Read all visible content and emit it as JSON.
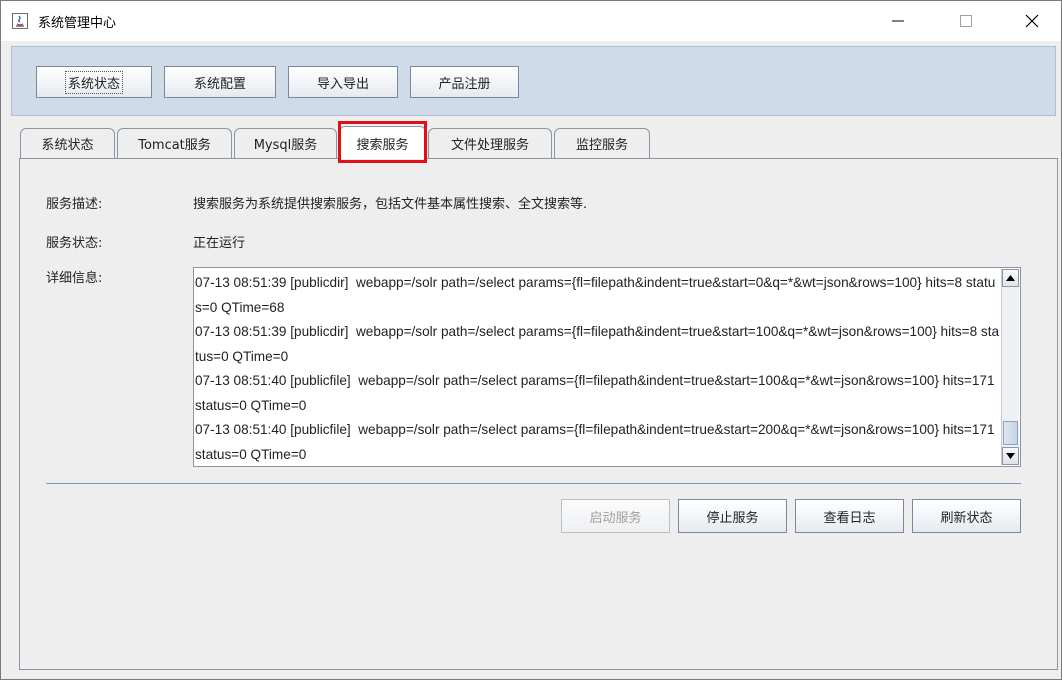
{
  "window": {
    "title": "系统管理中心"
  },
  "toolbar": {
    "buttons": [
      "系统状态",
      "系统配置",
      "导入导出",
      "产品注册"
    ]
  },
  "tabs": [
    "系统状态",
    "Tomcat服务",
    "Mysql服务",
    "搜索服务",
    "文件处理服务",
    "监控服务"
  ],
  "active_tab": "搜索服务",
  "service": {
    "desc_label": "服务描述:",
    "desc_value": "搜索服务为系统提供搜索服务，包括文件基本属性搜索、全文搜索等.",
    "status_label": "服务状态:",
    "status_value": "正在运行",
    "detail_label": "详细信息:",
    "log": "07-13 08:51:39 [publicdir]  webapp=/solr path=/select params={fl=filepath&indent=true&start=0&q=*&wt=json&rows=100} hits=8 status=0 QTime=68\n07-13 08:51:39 [publicdir]  webapp=/solr path=/select params={fl=filepath&indent=true&start=100&q=*&wt=json&rows=100} hits=8 status=0 QTime=0\n07-13 08:51:40 [publicfile]  webapp=/solr path=/select params={fl=filepath&indent=true&start=100&q=*&wt=json&rows=100} hits=171 status=0 QTime=0\n07-13 08:51:40 [publicfile]  webapp=/solr path=/select params={fl=filepath&indent=true&start=200&q=*&wt=json&rows=100} hits=171 status=0 QTime=0"
  },
  "actions": {
    "start": "启动服务",
    "stop": "停止服务",
    "logs": "查看日志",
    "refresh": "刷新状态"
  },
  "colors": {
    "highlight": "#e0101a",
    "toolbar_bg": "#cfdbe9"
  }
}
